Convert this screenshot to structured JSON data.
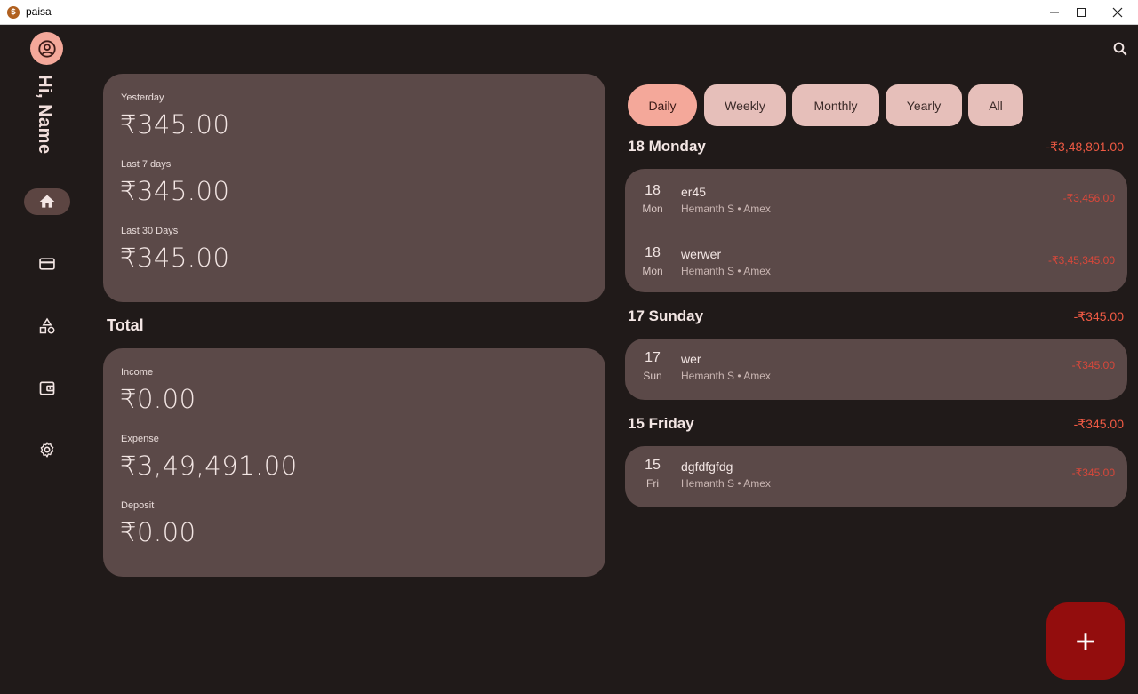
{
  "window": {
    "title": "paisa",
    "app_icon": "$"
  },
  "colors": {
    "accent": "#f4a89a",
    "card": "#5b4948",
    "background": "#201a19",
    "negative": "#d8473a",
    "fab": "#930d0d"
  },
  "sidebar": {
    "greeting": "Hi, Name",
    "items": [
      {
        "name": "home",
        "icon": "home-icon",
        "active": true
      },
      {
        "name": "cards",
        "icon": "credit-card-icon",
        "active": false
      },
      {
        "name": "category",
        "icon": "category-icon",
        "active": false
      },
      {
        "name": "wallet",
        "icon": "wallet-icon",
        "active": false
      },
      {
        "name": "settings",
        "icon": "gear-icon",
        "active": false
      }
    ]
  },
  "summary": {
    "yesterday": {
      "label": "Yesterday",
      "value": "₹345.00"
    },
    "last7": {
      "label": "Last 7 days",
      "value": "₹345.00"
    },
    "last30": {
      "label": "Last 30 Days",
      "value": "₹345.00"
    }
  },
  "total": {
    "title": "Total",
    "income": {
      "label": "Income",
      "value": "₹0.00"
    },
    "expense": {
      "label": "Expense",
      "value": "₹3,49,491.00"
    },
    "deposit": {
      "label": "Deposit",
      "value": "₹0.00"
    }
  },
  "filters": [
    {
      "label": "Daily",
      "active": true
    },
    {
      "label": "Weekly",
      "active": false
    },
    {
      "label": "Monthly",
      "active": false
    },
    {
      "label": "Yearly",
      "active": false
    },
    {
      "label": "All",
      "active": false
    }
  ],
  "groups": [
    {
      "title": "18 Monday",
      "total": "-₹3,48,801.00",
      "transactions": [
        {
          "day": "18",
          "dow": "Mon",
          "name": "er45",
          "sub": "Hemanth S • Amex",
          "amount": "-₹3,456.00"
        },
        {
          "day": "18",
          "dow": "Mon",
          "name": "werwer",
          "sub": "Hemanth S • Amex",
          "amount": "-₹3,45,345.00"
        }
      ]
    },
    {
      "title": "17 Sunday",
      "total": "-₹345.00",
      "transactions": [
        {
          "day": "17",
          "dow": "Sun",
          "name": "wer",
          "sub": "Hemanth S • Amex",
          "amount": "-₹345.00"
        }
      ]
    },
    {
      "title": "15 Friday",
      "total": "-₹345.00",
      "transactions": [
        {
          "day": "15",
          "dow": "Fri",
          "name": "dgfdfgfdg",
          "sub": "Hemanth S • Amex",
          "amount": "-₹345.00"
        }
      ]
    }
  ],
  "fab": {
    "icon": "plus-icon"
  },
  "search": {
    "icon": "search-icon"
  }
}
